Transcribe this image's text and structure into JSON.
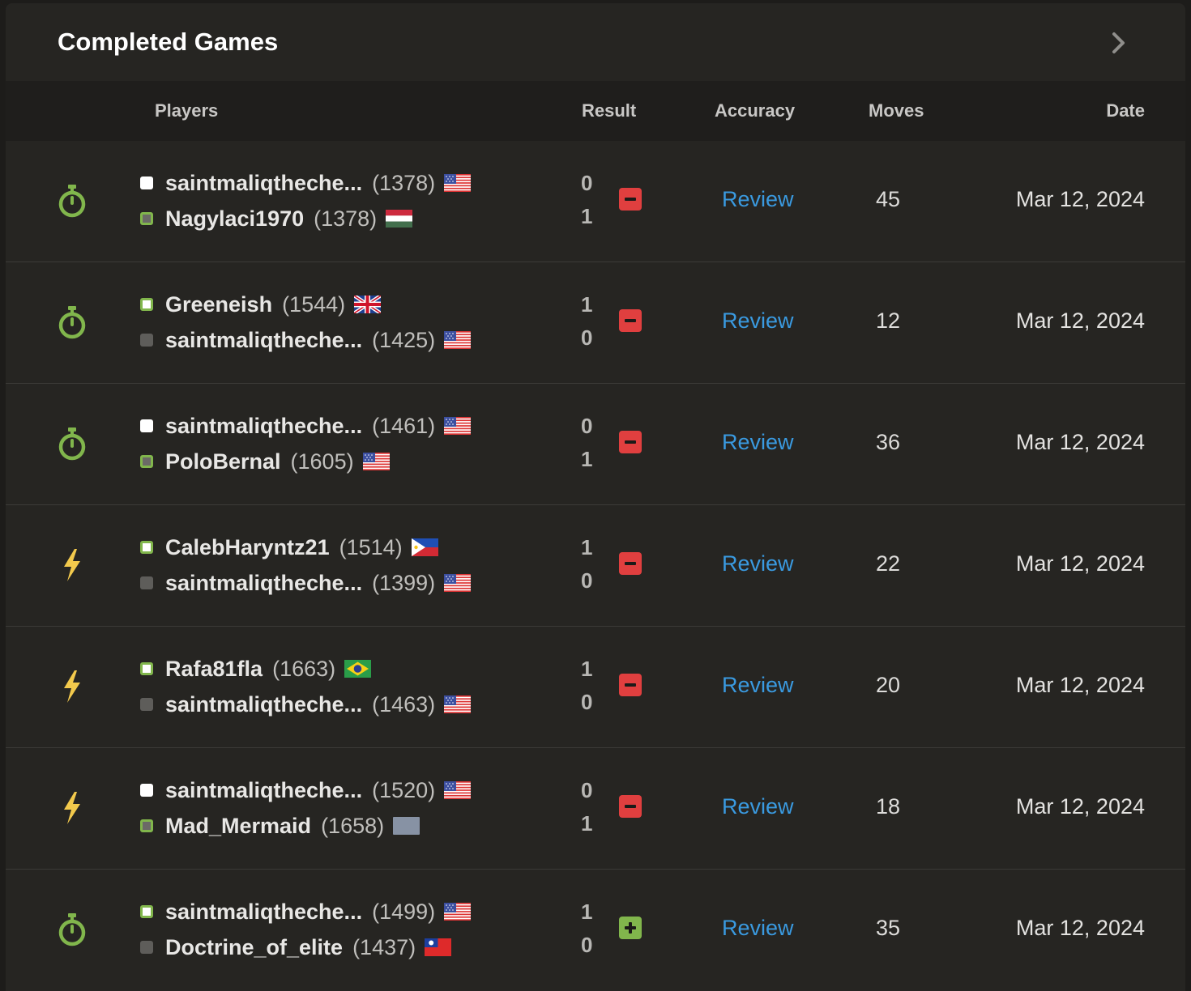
{
  "header": {
    "title": "Completed Games"
  },
  "columns": {
    "players": "Players",
    "result": "Result",
    "accuracy": "Accuracy",
    "moves": "Moves",
    "date": "Date"
  },
  "colors": {
    "green": "#81b64c",
    "loss": "#e03f3f",
    "blitz": "#f2c94c",
    "link": "#3a9ae0"
  },
  "games": [
    {
      "type": "rapid-stopwatch-icon",
      "white": {
        "name": "saintmaliqtheche...",
        "rating": "(1378)",
        "flag": "us"
      },
      "black": {
        "name": "Nagylaci1970",
        "rating": "(1378)",
        "flag": "hu"
      },
      "score_white": "0",
      "score_black": "1",
      "outcome": "loss",
      "accuracy": "Review",
      "moves": "45",
      "date": "Mar 12, 2024"
    },
    {
      "type": "rapid-stopwatch-icon",
      "white": {
        "name": "Greeneish",
        "rating": "(1544)",
        "flag": "gb"
      },
      "black": {
        "name": "saintmaliqtheche...",
        "rating": "(1425)",
        "flag": "us"
      },
      "score_white": "1",
      "score_black": "0",
      "outcome": "loss",
      "accuracy": "Review",
      "moves": "12",
      "date": "Mar 12, 2024"
    },
    {
      "type": "rapid-stopwatch-icon",
      "white": {
        "name": "saintmaliqtheche...",
        "rating": "(1461)",
        "flag": "us"
      },
      "black": {
        "name": "PoloBernal",
        "rating": "(1605)",
        "flag": "us"
      },
      "score_white": "0",
      "score_black": "1",
      "outcome": "loss",
      "accuracy": "Review",
      "moves": "36",
      "date": "Mar 12, 2024"
    },
    {
      "type": "blitz-bolt-icon",
      "white": {
        "name": "CalebHaryntz21",
        "rating": "(1514)",
        "flag": "ph"
      },
      "black": {
        "name": "saintmaliqtheche...",
        "rating": "(1399)",
        "flag": "us"
      },
      "score_white": "1",
      "score_black": "0",
      "outcome": "loss",
      "accuracy": "Review",
      "moves": "22",
      "date": "Mar 12, 2024"
    },
    {
      "type": "blitz-bolt-icon",
      "white": {
        "name": "Rafa81fla",
        "rating": "(1663)",
        "flag": "br"
      },
      "black": {
        "name": "saintmaliqtheche...",
        "rating": "(1463)",
        "flag": "us"
      },
      "score_white": "1",
      "score_black": "0",
      "outcome": "loss",
      "accuracy": "Review",
      "moves": "20",
      "date": "Mar 12, 2024"
    },
    {
      "type": "blitz-bolt-icon",
      "white": {
        "name": "saintmaliqtheche...",
        "rating": "(1520)",
        "flag": "us"
      },
      "black": {
        "name": "Mad_Mermaid",
        "rating": "(1658)",
        "flag": "unknown"
      },
      "score_white": "0",
      "score_black": "1",
      "outcome": "loss",
      "accuracy": "Review",
      "moves": "18",
      "date": "Mar 12, 2024"
    },
    {
      "type": "rapid-stopwatch-icon",
      "white": {
        "name": "saintmaliqtheche...",
        "rating": "(1499)",
        "flag": "us"
      },
      "black": {
        "name": "Doctrine_of_elite",
        "rating": "(1437)",
        "flag": "tw"
      },
      "score_white": "1",
      "score_black": "0",
      "outcome": "win",
      "accuracy": "Review",
      "moves": "35",
      "date": "Mar 12, 2024"
    }
  ]
}
